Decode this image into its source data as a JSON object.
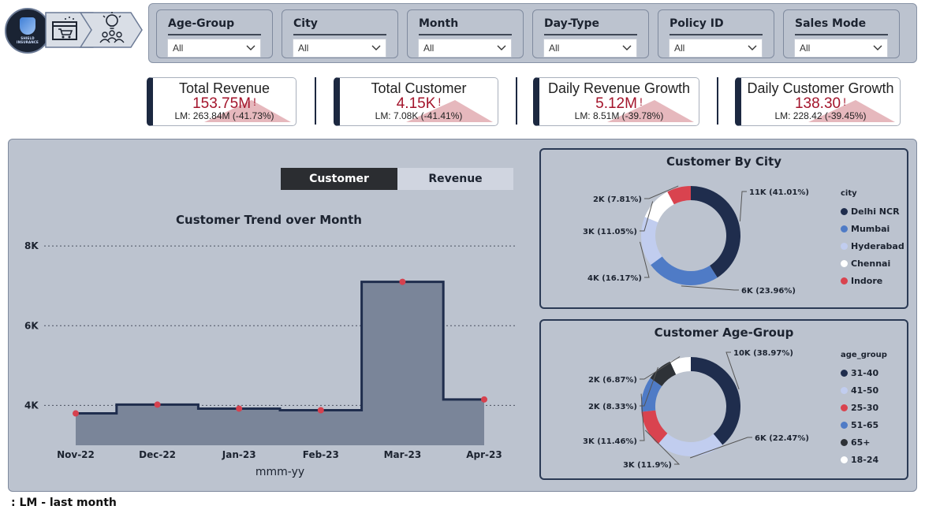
{
  "logo": {
    "text_line1": "SHIELD",
    "text_line2": "INSURANCE"
  },
  "nav": {
    "icons": [
      "cart-browser-icon",
      "idea-team-icon"
    ]
  },
  "slicers": [
    {
      "title": "Age-Group",
      "value": "All"
    },
    {
      "title": "City",
      "value": "All"
    },
    {
      "title": "Month",
      "value": "All"
    },
    {
      "title": "Day-Type",
      "value": "All"
    },
    {
      "title": "Policy ID",
      "value": "All"
    },
    {
      "title": "Sales Mode",
      "value": "All"
    }
  ],
  "kpis": [
    {
      "title": "Total Revenue",
      "value": "153.75M",
      "flag": "!",
      "lm": "LM: 263.84M (-41.73%)"
    },
    {
      "title": "Total Customer",
      "value": "4.15K",
      "flag": "!",
      "lm": "LM: 7.08K (-41.41%)"
    },
    {
      "title": "Daily Revenue Growth",
      "value": "5.12M",
      "flag": "!",
      "lm": "LM: 8.51M (-39.78%)"
    },
    {
      "title": "Daily Customer Growth",
      "value": "138.30",
      "flag": "!",
      "lm": "LM: 228.42 (-39.45%)"
    }
  ],
  "toggle": {
    "active": "Customer",
    "inactive": "Revenue"
  },
  "colors": {
    "navy": "#1f2d4d",
    "blue": "#4f7bc6",
    "lightblue": "#c1cdef",
    "white": "#ffffff",
    "red": "#d9434f",
    "dark": "#2e3237",
    "area": "#7a8599",
    "marker": "#d6414e"
  },
  "chart_data": [
    {
      "type": "area",
      "title": "Customer Trend over Month",
      "xlabel": "mmm-yy",
      "ylabel": "",
      "categories": [
        "Nov-22",
        "Dec-22",
        "Jan-23",
        "Feb-23",
        "Mar-23",
        "Apr-23"
      ],
      "values": [
        3800,
        4020,
        3920,
        3880,
        7100,
        4150
      ],
      "yticks": [
        "4K",
        "6K",
        "8K"
      ],
      "ylim": [
        3000,
        8200
      ],
      "grid": true,
      "step": true
    },
    {
      "type": "pie",
      "title": "Customer By City",
      "legend_title": "city",
      "legend_position": "right",
      "slices": [
        {
          "name": "Delhi NCR",
          "share": 41.01,
          "label": "11K (41.01%)",
          "color": "#1f2d4d"
        },
        {
          "name": "Mumbai",
          "share": 23.96,
          "label": "6K (23.96%)",
          "color": "#4f7bc6"
        },
        {
          "name": "Hyderabad",
          "share": 16.17,
          "label": "4K (16.17%)",
          "color": "#c1cdef"
        },
        {
          "name": "Chennai",
          "share": 11.05,
          "label": "3K (11.05%)",
          "color": "#ffffff"
        },
        {
          "name": "Indore",
          "share": 7.81,
          "label": "2K (7.81%)",
          "color": "#d9434f"
        }
      ]
    },
    {
      "type": "pie",
      "title": "Customer Age-Group",
      "legend_title": "age_group",
      "legend_position": "right",
      "slices": [
        {
          "name": "31-40",
          "share": 38.97,
          "label": "10K (38.97%)",
          "color": "#1f2d4d"
        },
        {
          "name": "41-50",
          "share": 22.47,
          "label": "6K (22.47%)",
          "color": "#c1cdef"
        },
        {
          "name": "25-30",
          "share": 11.9,
          "label": "3K (11.9%)",
          "color": "#d9434f"
        },
        {
          "name": "51-65",
          "share": 11.46,
          "label": "3K (11.46%)",
          "color": "#4f7bc6"
        },
        {
          "name": "65+",
          "share": 8.33,
          "label": "2K (8.33%)",
          "color": "#2e3237"
        },
        {
          "name": "18-24",
          "share": 6.87,
          "label": "2K (6.87%)",
          "color": "#ffffff"
        }
      ]
    }
  ],
  "footnote": ": LM - last month"
}
